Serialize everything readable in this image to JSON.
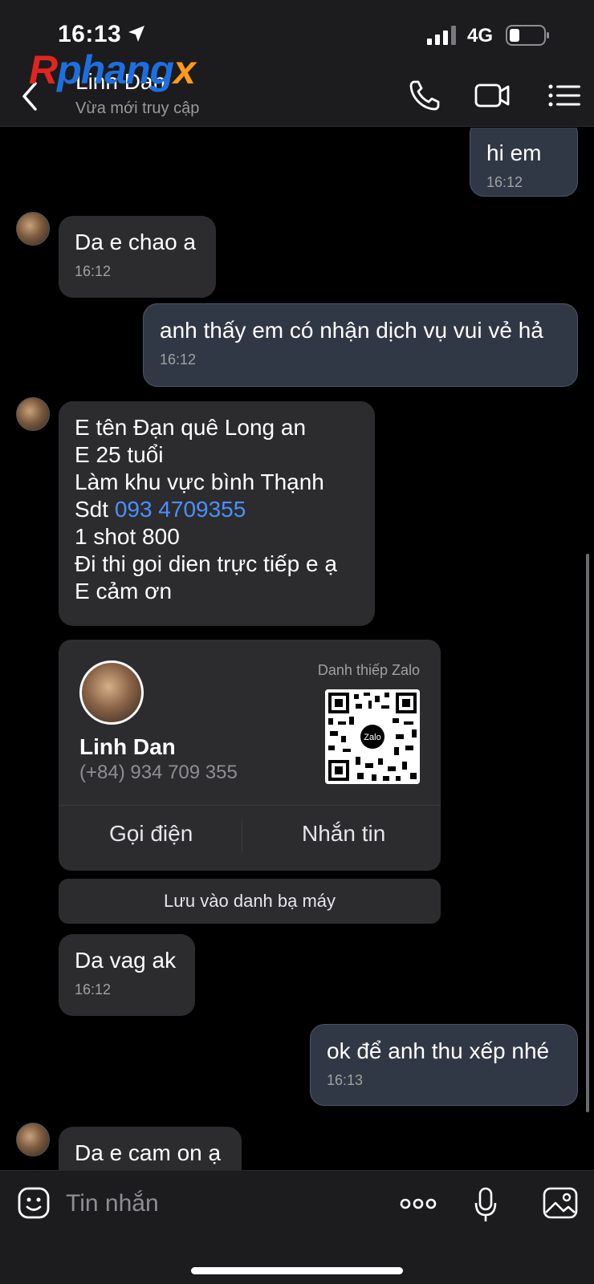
{
  "status_bar": {
    "time": "16:13",
    "network": "4G"
  },
  "watermark": {
    "part1": "R",
    "part2": "phang",
    "part3": "x"
  },
  "header": {
    "name": "Linh Dan",
    "status": "Vừa mới truy cập"
  },
  "messages": {
    "m1": {
      "text": "hi em",
      "time": "16:12"
    },
    "m2": {
      "text": "Da e chao a",
      "time": "16:12"
    },
    "m3": {
      "text": "anh thấy em có nhận dịch vụ vui vẻ hả",
      "time": "16:12"
    },
    "m4": {
      "line1": "E tên Đạn quê Long an",
      "line2": "E 25 tuổi",
      "line3": "Làm khu vực bình Thạnh",
      "line4_prefix": "Sdt ",
      "line4_phone": "093 4709355",
      "line5": "1 shot 800",
      "line6": "Đi thi goi dien trực tiếp e ạ",
      "line7": "E cảm ơn"
    },
    "m5": {
      "text": "Da vag ak",
      "time": "16:12"
    },
    "m6": {
      "text": "ok để anh thu xếp nhé",
      "time": "16:13"
    },
    "m7": {
      "text": "Da e cam on ạ"
    }
  },
  "contact_card": {
    "label": "Danh thiếp Zalo",
    "qr_text": "Zalo",
    "name": "Linh Dan",
    "phone": "(+84) 934 709 355",
    "call_label": "Gọi điện",
    "message_label": "Nhắn tin",
    "save_label": "Lưu vào danh bạ máy"
  },
  "input": {
    "placeholder": "Tin nhắn"
  },
  "icons": [
    "location-arrow-icon",
    "signal-icon",
    "battery-icon",
    "back-icon",
    "phone-icon",
    "video-icon",
    "menu-icon",
    "emoji-icon",
    "more-icon",
    "microphone-icon",
    "image-icon"
  ],
  "colors": {
    "background": "#000000",
    "bar": "#1c1c1e",
    "incoming": "#2c2c2e",
    "outgoing": "#313845",
    "link": "#4a90ff"
  }
}
